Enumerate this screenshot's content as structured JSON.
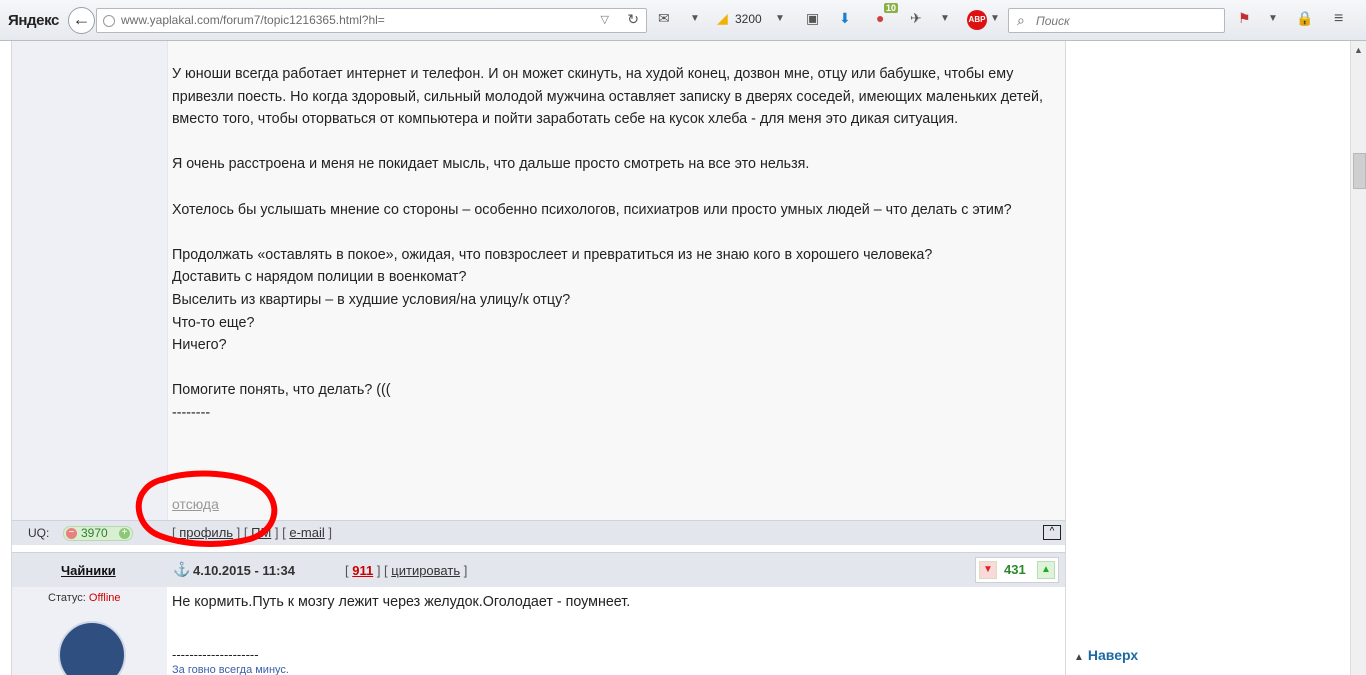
{
  "browser": {
    "brand": "Яндекс",
    "url": "www.yaplakal.com/forum7/topic1216365.html?hl=",
    "search_placeholder": "Поиск",
    "counter": "3200",
    "badge": "10",
    "abp": "ABP"
  },
  "post": {
    "paragraphs": [
      "У юноши всегда работает интернет и телефон. И он может скинуть, на худой конец, дозвон мне, отцу или бабушке, чтобы ему привезли поесть. Но когда здоровый, сильный молодой мужчина оставляет записку в дверях соседей, имеющих маленьких детей, вместо того, чтобы оторваться от компьютера и пойти заработать себе на кусок хлеба - для меня это дикая ситуация.",
      "Я очень расстроена и меня не покидает мысль, что дальше просто смотреть на все это нельзя.",
      "Хотелось бы услышать мнение со стороны – особенно психологов, психиатров или просто умных людей – что делать с этим?"
    ],
    "list_lines": [
      "Продолжать «оставлять в покое», ожидая, что повзрослеет и превратиться из не знаю кого в хорошего человека?",
      "Доставить с нарядом полиции в военкомат?",
      "Выселить из квартиры – в худшие условия/на улицу/к отцу?",
      "Что-то еще?",
      "Ничего?"
    ],
    "final_line": "Помогите понять, что делать? (((",
    "separator": "--------",
    "source_link": "отсюда",
    "footer": {
      "uq_label": "UQ:",
      "reputation": "3970",
      "profile": "профиль",
      "pm": "ПМ",
      "email": "e-mail",
      "top_button": "^"
    }
  },
  "post2": {
    "author": "Чайники",
    "date": "4.10.2015 - 11:34",
    "number": "911",
    "quote": "цитировать",
    "score": "431",
    "status_label": "Статус:",
    "status_value": "Offline",
    "text": "Не кормить.Путь к мозгу лежит через желудок.Оголодает - поумнеет.",
    "signature_line": "--------------------",
    "signature": "За говно всегда минус."
  },
  "naverh": "Наверх",
  "colors": {
    "highlight_circle": "#ff0000",
    "reputation": "#2f7d2b",
    "score": "#2a8a2a",
    "link_blue": "#1d6aa3"
  },
  "icons": [
    "back-arrow-icon",
    "reload-icon",
    "mail-icon",
    "pocket-icon",
    "download-icon",
    "abp-icon",
    "search-icon",
    "lock-icon",
    "anchor-icon",
    "thumb-down-icon",
    "thumb-up-icon"
  ]
}
